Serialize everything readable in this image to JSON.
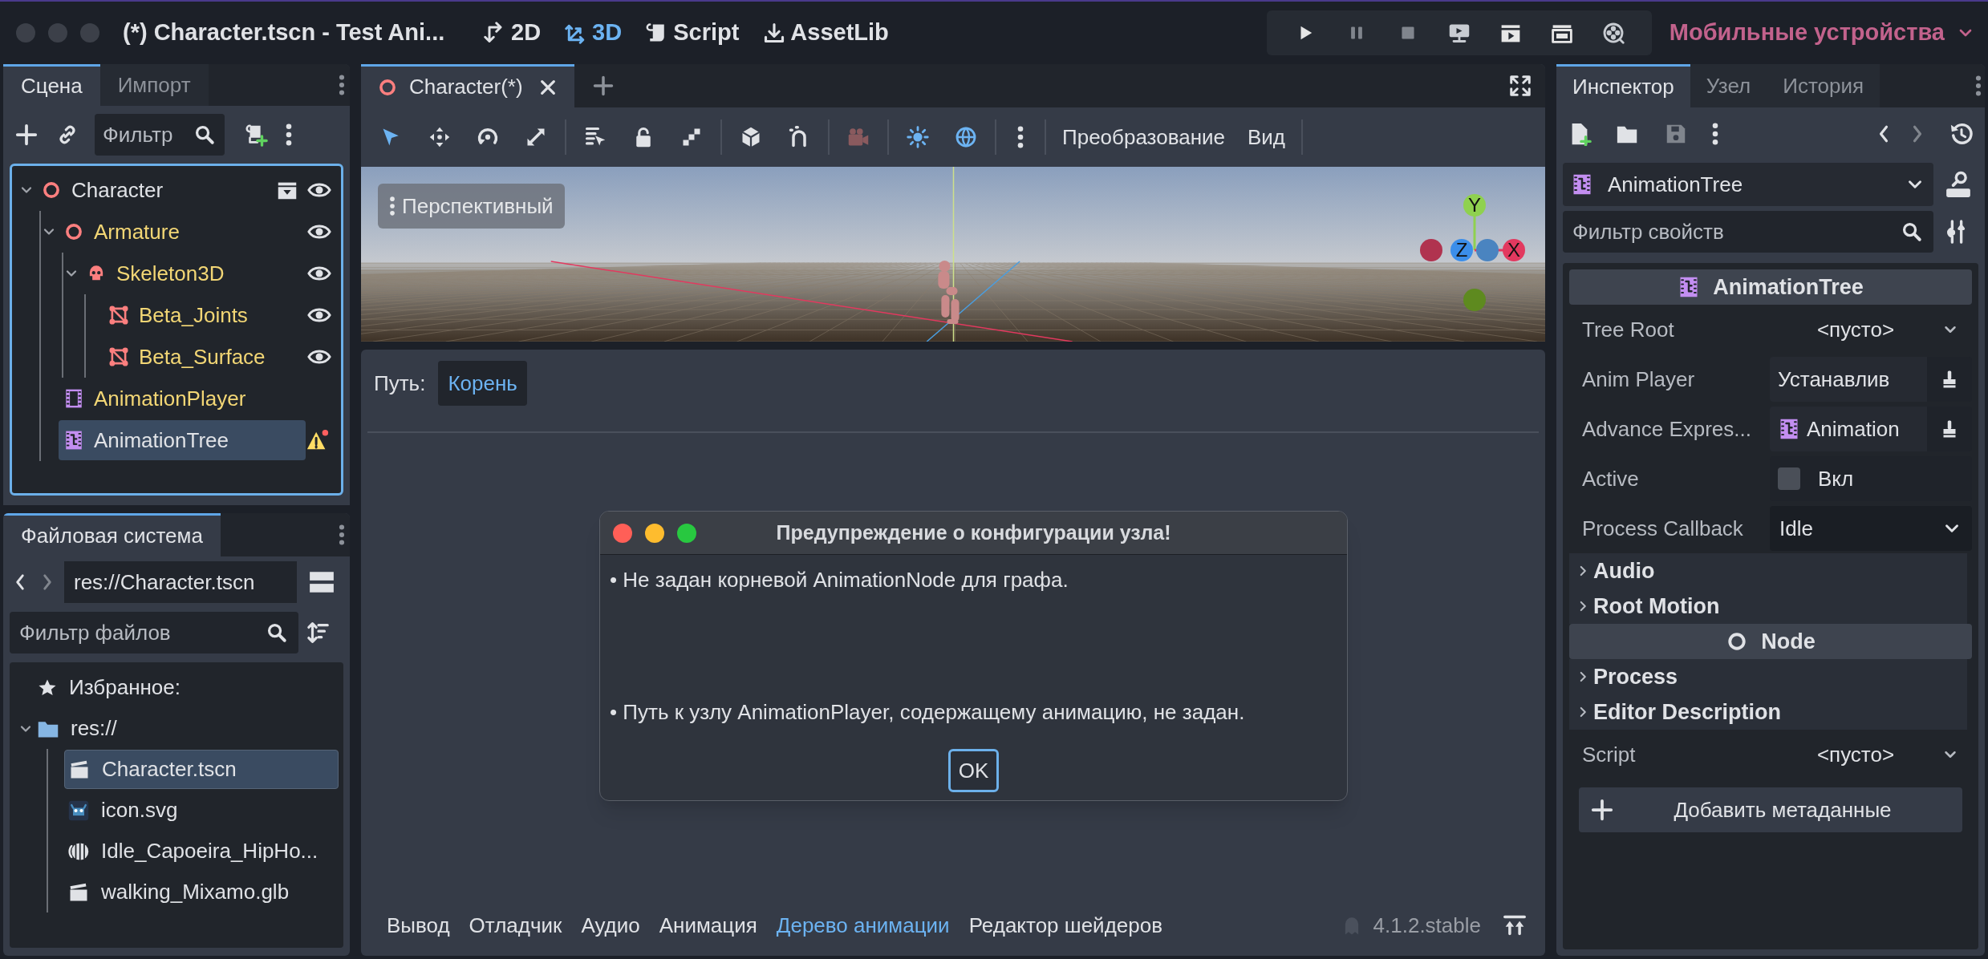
{
  "window": {
    "title": "(*) Character.tscn - Test Ani..."
  },
  "main_tabs": [
    {
      "label": "2D",
      "kind": "planar",
      "selected": false
    },
    {
      "label": "3D",
      "kind": "spatial",
      "selected": true
    },
    {
      "label": "Script",
      "kind": "script",
      "selected": false
    },
    {
      "label": "AssetLib",
      "kind": "assetlib",
      "selected": false
    }
  ],
  "renderer": "Мобильные устройства",
  "scene_dock": {
    "tabs": [
      {
        "label": "Сцена",
        "selected": true
      },
      {
        "label": "Импорт",
        "selected": false
      }
    ],
    "filter_placeholder": "Фильтр",
    "tree": [
      {
        "name": "Character",
        "kind": "node3d",
        "inherited": false,
        "expanded": true,
        "scene_instance": true,
        "visible": true,
        "selected": false,
        "children": [
          {
            "name": "Armature",
            "kind": "node3d",
            "inherited": true,
            "expanded": true,
            "visible": true,
            "selected": false,
            "children": [
              {
                "name": "Skeleton3D",
                "kind": "skeleton",
                "inherited": true,
                "expanded": true,
                "visible": true,
                "selected": false,
                "children": [
                  {
                    "name": "Beta_Joints",
                    "kind": "mesh",
                    "inherited": true,
                    "visible": true,
                    "selected": false
                  },
                  {
                    "name": "Beta_Surface",
                    "kind": "mesh",
                    "inherited": true,
                    "visible": true,
                    "selected": false
                  }
                ]
              }
            ]
          },
          {
            "name": "AnimationPlayer",
            "kind": "anim_player",
            "inherited": true,
            "selected": false
          },
          {
            "name": "AnimationTree",
            "kind": "anim_tree",
            "inherited": false,
            "selected": true,
            "warning": true
          }
        ]
      }
    ]
  },
  "filesystem": {
    "tab": "Файловая система",
    "path": "res://Character.tscn",
    "filter_placeholder": "Фильтр файлов",
    "favorites": "Избранное:",
    "tree": [
      {
        "name": "res://",
        "kind": "folder",
        "expanded": true,
        "selected": false,
        "children": [
          {
            "name": "Character.tscn",
            "kind": "scene",
            "selected": true
          },
          {
            "name": "icon.svg",
            "kind": "image",
            "selected": false
          },
          {
            "name": "Idle_Capoeira_HipHo...",
            "kind": "animation",
            "selected": false
          },
          {
            "name": "walking_Mixamo.glb",
            "kind": "scene",
            "selected": false
          }
        ]
      }
    ]
  },
  "editor_tabs": [
    {
      "label": "Character(*)",
      "selected": true
    }
  ],
  "viewport_toolbar": {
    "tools": [
      {
        "kind": "select",
        "active": true
      },
      {
        "kind": "move",
        "active": false
      },
      {
        "kind": "rotate",
        "active": false
      },
      {
        "kind": "scale",
        "active": false
      },
      {
        "kind": "list",
        "active": false
      },
      {
        "kind": "lock",
        "active": false
      },
      {
        "kind": "group",
        "active": false
      },
      {
        "kind": "cube",
        "active": false
      },
      {
        "kind": "snap",
        "active": false
      },
      {
        "kind": "camera",
        "active": false
      },
      {
        "kind": "sun",
        "active": true
      },
      {
        "kind": "globe",
        "active": true
      }
    ],
    "menus": [
      "Преобразование",
      "Вид"
    ]
  },
  "viewport": {
    "view_label": "Перспективный",
    "gizmo_labels": [
      "Y",
      "Z",
      "X"
    ]
  },
  "animation_tree_editor": {
    "path_label": "Путь:",
    "path_root": "Корень"
  },
  "dialog": {
    "title": "Предупреждение о конфигурации узла!",
    "messages": [
      "•  Не задан корневой AnimationNode для графа.",
      "•  Путь к узлу AnimationPlayer, содержащему анимацию, не задан."
    ],
    "button": "OK"
  },
  "bottom_tabs": [
    {
      "label": "Вывод",
      "selected": false
    },
    {
      "label": "Отладчик",
      "selected": false
    },
    {
      "label": "Аудио",
      "selected": false
    },
    {
      "label": "Анимация",
      "selected": false
    },
    {
      "label": "Дерево анимации",
      "selected": true
    },
    {
      "label": "Редактор шейдеров",
      "selected": false
    }
  ],
  "version": "4.1.2.stable",
  "inspector": {
    "tabs": [
      {
        "label": "Инспектор",
        "selected": true
      },
      {
        "label": "Узел",
        "selected": false
      },
      {
        "label": "История",
        "selected": false
      }
    ],
    "object": "AnimationTree",
    "filter_placeholder": "Фильтр свойств",
    "items": [
      {
        "kind": "category",
        "label": "AnimationTree"
      },
      {
        "kind": "resource",
        "label": "Tree Root",
        "value": "<пусто>"
      },
      {
        "kind": "nodepath",
        "label": "Anim Player",
        "value": "Устанавлив"
      },
      {
        "kind": "nodepath",
        "label": "Advance Expres...",
        "value": "Animation",
        "value_icon": true
      },
      {
        "kind": "checkbox",
        "label": "Active",
        "value": "Вкл",
        "checked": false
      },
      {
        "kind": "enum",
        "label": "Process Callback",
        "value": "Idle"
      },
      {
        "kind": "group",
        "label": "Audio",
        "expanded": false
      },
      {
        "kind": "group",
        "label": "Root Motion",
        "expanded": false
      },
      {
        "kind": "category",
        "label": "Node"
      },
      {
        "kind": "group",
        "label": "Process",
        "expanded": false
      },
      {
        "kind": "group",
        "label": "Editor Description",
        "expanded": false
      },
      {
        "kind": "resource",
        "label": "Script",
        "value": "<пусто>"
      },
      {
        "kind": "button",
        "label": "Добавить метаданные"
      }
    ]
  }
}
